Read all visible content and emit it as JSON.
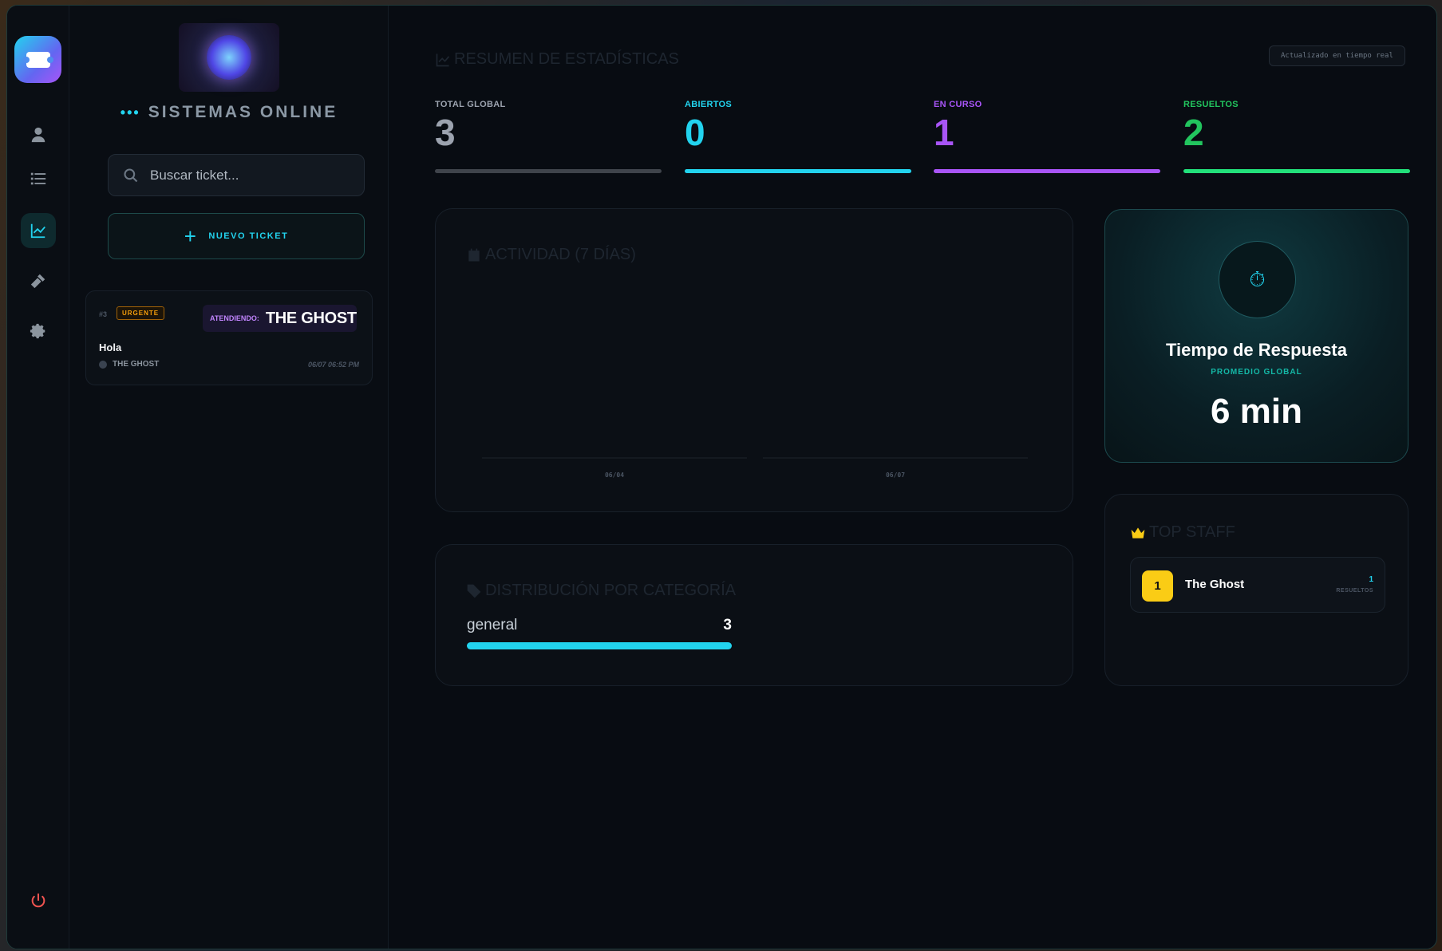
{
  "sidebar": {
    "status_dots": "•••",
    "status_text": "SISTEMAS ONLINE",
    "search_placeholder": "Buscar ticket...",
    "new_ticket_icon": "+",
    "new_ticket_label": "NUEVO TICKET",
    "tickets": [
      {
        "id": "#3",
        "badge": "URGENTE",
        "attending_label": "ATENDIENDO:",
        "attending_name": "THE GHOST",
        "title": "Hola",
        "user": "THE GHOST",
        "date": "06/07 06:52 PM"
      }
    ]
  },
  "rail": {
    "items": [
      "user-icon",
      "list-icon",
      "chart-icon",
      "hammer-icon",
      "gear-icon"
    ],
    "active": "chart-icon",
    "bottom": "power-icon"
  },
  "stats": {
    "title": "RESUMEN DE ESTADÍSTICAS",
    "live_label": "Actualizado en tiempo real",
    "kpis": [
      {
        "label": "TOTAL GLOBAL",
        "value": "3",
        "color": "#9ca3af",
        "bar": "#3f444b"
      },
      {
        "label": "ABIERTOS",
        "value": "0",
        "color": "#22d3ee",
        "bar": "#22d3ee"
      },
      {
        "label": "EN CURSO",
        "value": "1",
        "color": "#a855f7",
        "bar": "#a855f7"
      },
      {
        "label": "RESUELTOS",
        "value": "2",
        "color": "#22c55e",
        "bar": "#22e07a"
      }
    ]
  },
  "activity": {
    "title": "ACTIVIDAD (7 DÍAS)"
  },
  "chart_data": {
    "type": "bar",
    "title": "ACTIVIDAD (7 DÍAS)",
    "categories": [
      "06/04",
      "06/07"
    ],
    "values": [
      0,
      0
    ]
  },
  "response": {
    "icon": "⏱",
    "title": "Tiempo de Respuesta",
    "subtitle": "PROMEDIO GLOBAL",
    "value": "6 min"
  },
  "categories": {
    "title": "DISTRIBUCIÓN POR CATEGORÍA",
    "items": [
      {
        "name": "general",
        "count": "3",
        "fraction": 1.0
      }
    ]
  },
  "top_staff": {
    "title": "TOP STAFF",
    "items": [
      {
        "rank": "1",
        "name": "The Ghost",
        "count": "1",
        "label": "RESUELTOS"
      }
    ]
  }
}
